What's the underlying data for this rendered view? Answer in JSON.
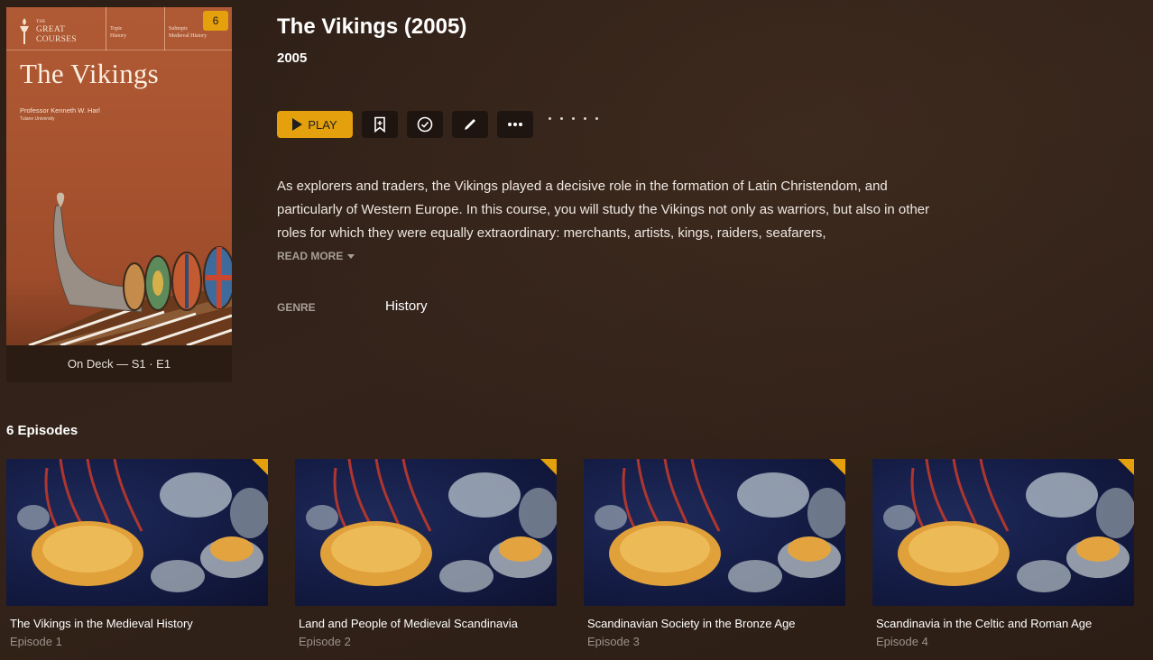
{
  "poster": {
    "logo_the": "THE",
    "logo_line1": "GREAT",
    "logo_line2": "COURSES",
    "topic_label": "Topic",
    "topic_value": "History",
    "subtopic_label": "Subtopic",
    "subtopic_value": "Medieval History",
    "episode_count_badge": "6",
    "title": "The Vikings",
    "professor": "Professor Kenneth W. Harl",
    "university": "Tulane University",
    "ondeck": "On Deck — S1 · E1"
  },
  "show": {
    "title": "The Vikings (2005)",
    "year": "2005",
    "summary": "As explorers and traders, the Vikings played a decisive role in the formation of Latin Christendom, and particularly of Western Europe. In this course, you will study the Vikings not only as warriors, but also in other roles for which they were equally extraordinary: merchants, artists, kings, raiders, seafarers,",
    "read_more": "READ MORE",
    "genre_label": "GENRE",
    "genre_value": "History"
  },
  "actions": {
    "play_label": "PLAY",
    "icons": [
      "bookmark-icon",
      "check-circle-icon",
      "pencil-icon",
      "more-icon"
    ],
    "rating_dots": 5
  },
  "episodes": {
    "heading": "6 Episodes",
    "items": [
      {
        "title": "The Vikings in the Medieval History",
        "subtitle": "Episode 1"
      },
      {
        "title": "Land and People of Medieval Scandinavia",
        "subtitle": "Episode 2"
      },
      {
        "title": "Scandinavian Society in the Bronze Age",
        "subtitle": "Episode 3"
      },
      {
        "title": "Scandinavia in the Celtic and Roman Age",
        "subtitle": "Episode 4"
      }
    ]
  },
  "colors": {
    "accent": "#e5a00d",
    "background": "#33231a",
    "muted_text": "#a89f98"
  }
}
